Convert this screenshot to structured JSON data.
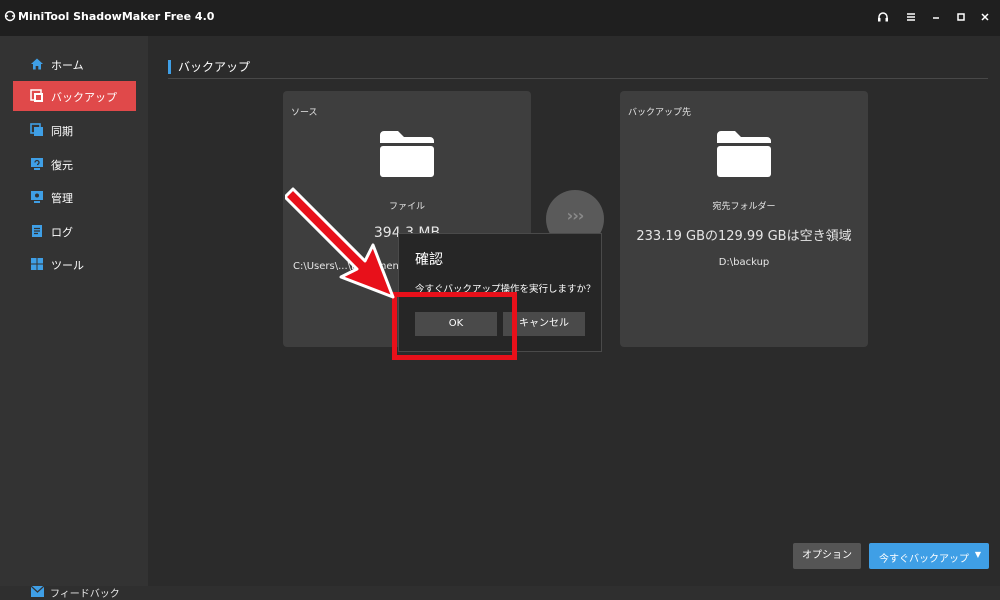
{
  "app": {
    "title": "MiniTool ShadowMaker Free 4.0"
  },
  "window_controls": [
    "headset-icon",
    "menu-icon",
    "minimize-icon",
    "maximize-icon",
    "close-icon"
  ],
  "sidebar": {
    "items": [
      {
        "label": "ホーム",
        "icon": "home-icon",
        "active": false
      },
      {
        "label": "バックアップ",
        "icon": "backup-icon",
        "active": true
      },
      {
        "label": "同期",
        "icon": "sync-icon",
        "active": false
      },
      {
        "label": "復元",
        "icon": "restore-icon",
        "active": false
      },
      {
        "label": "管理",
        "icon": "manage-icon",
        "active": false
      },
      {
        "label": "ログ",
        "icon": "log-icon",
        "active": false
      },
      {
        "label": "ツール",
        "icon": "tools-icon",
        "active": false
      }
    ],
    "feedback": "フィードバック"
  },
  "main": {
    "title": "バックアップ",
    "source": {
      "label": "ソース",
      "type": "ファイル",
      "size": "394.3 MB",
      "path": "C:\\Users\\...\\Documents"
    },
    "destination": {
      "label": "バックアップ先",
      "type": "宛先フォルダー",
      "space": "233.19 GBの129.99 GBは空き領域",
      "path": "D:\\backup"
    }
  },
  "dialog": {
    "title": "確認",
    "message": "今すぐバックアップ操作を実行しますか？",
    "ok": "OK",
    "cancel": "キャンセル"
  },
  "footer": {
    "options": "オプション",
    "backup_now": "今すぐバックアップ"
  },
  "colors": {
    "accent": "#3f9fe6",
    "active": "#e0494a",
    "highlight": "#e8101a"
  }
}
